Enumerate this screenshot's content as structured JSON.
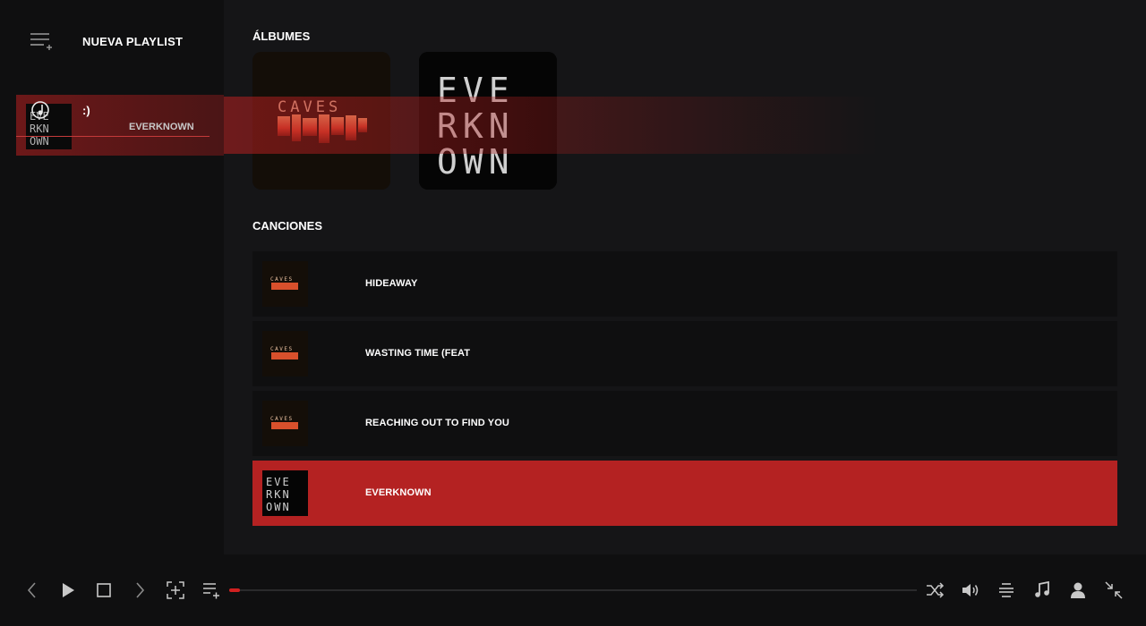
{
  "sidebar": {
    "new_playlist_label": "NUEVA PLAYLIST",
    "playlists": [
      {
        "name": ":)",
        "subtitle": "EVERKNOWN"
      }
    ]
  },
  "main": {
    "albums_title": "ÁLBUMES",
    "albums": [
      {
        "art_text": "CAVES",
        "art": "caves"
      },
      {
        "art_text": [
          "EVE",
          "RKN",
          "OWN"
        ],
        "art": "everknown"
      }
    ],
    "songs_title": "CANCIONES",
    "songs": [
      {
        "title": "HIDEAWAY",
        "art": "caves"
      },
      {
        "title": "WASTING TIME (FEAT",
        "art": "caves"
      },
      {
        "title": "REACHING OUT TO FIND YOU",
        "art": "caves"
      },
      {
        "title": "EVERKNOWN",
        "art": "everknown"
      }
    ],
    "active_song": 3
  },
  "player": {
    "progress": 0.015,
    "icons": {
      "prev": "chevron-left-icon",
      "play": "play-icon",
      "stop": "stop-icon",
      "next": "chevron-right-icon",
      "focus": "focus-add-icon",
      "add_to_playlist": "playlist-add-icon",
      "shuffle": "shuffle-icon",
      "volume": "volume-icon",
      "queue": "queue-icon",
      "music": "music-note-icon",
      "profile": "user-icon",
      "minimize": "minimize-icon"
    }
  },
  "colors": {
    "accent": "#b42222",
    "background": "#151517",
    "sidebar": "#0f0f10"
  }
}
